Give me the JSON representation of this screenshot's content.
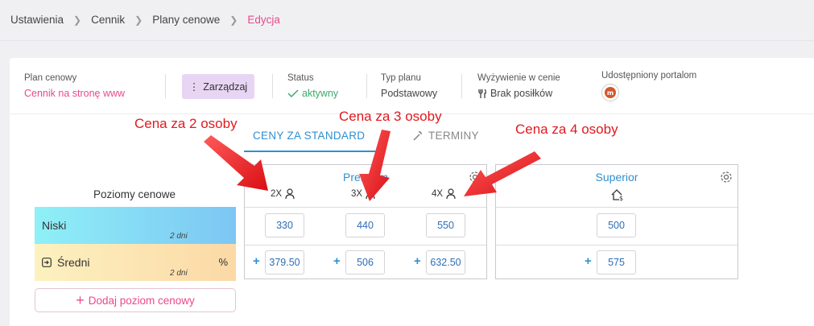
{
  "breadcrumb": [
    "Ustawienia",
    "Cennik",
    "Plany cenowe",
    "Edycja"
  ],
  "info": {
    "plan_label": "Plan cenowy",
    "plan_value": "Cennik na stronę www",
    "manage_label": "Zarządzaj",
    "status_label": "Status",
    "status_value": "aktywny",
    "type_label": "Typ planu",
    "type_value": "Podstawowy",
    "meal_label": "Wyżywienie w cenie",
    "meal_value": "Brak posiłków",
    "portal_label": "Udostępniony portalom",
    "portal_icon_text": "m"
  },
  "tabs": {
    "active": "CENY ZA STANDARD",
    "inactive": "TERMINY"
  },
  "levels": {
    "title": "Poziomy cenowe",
    "items": [
      {
        "name": "Niski",
        "days": "2 dni"
      },
      {
        "name": "Średni",
        "days": "2 dni",
        "suffix": "%"
      }
    ],
    "add_label": "Dodaj poziom cenowy"
  },
  "rooms": [
    {
      "name": "Premium",
      "occupancy": [
        "2X",
        "3X",
        "4X"
      ],
      "row1": [
        "330",
        "440",
        "550"
      ],
      "row2": [
        "379.50",
        "506",
        "632.50"
      ]
    },
    {
      "name": "Superior",
      "row1": [
        "500"
      ],
      "row2": [
        "575"
      ]
    }
  ],
  "annotations": [
    "Cena za 2 osoby",
    "Cena za 3 osoby",
    "Cena za 4 osoby"
  ],
  "colors": {
    "accent": "#e9498a",
    "blue": "#2f8fd1",
    "green": "#3aab6b",
    "annotation": "#e0191e"
  }
}
